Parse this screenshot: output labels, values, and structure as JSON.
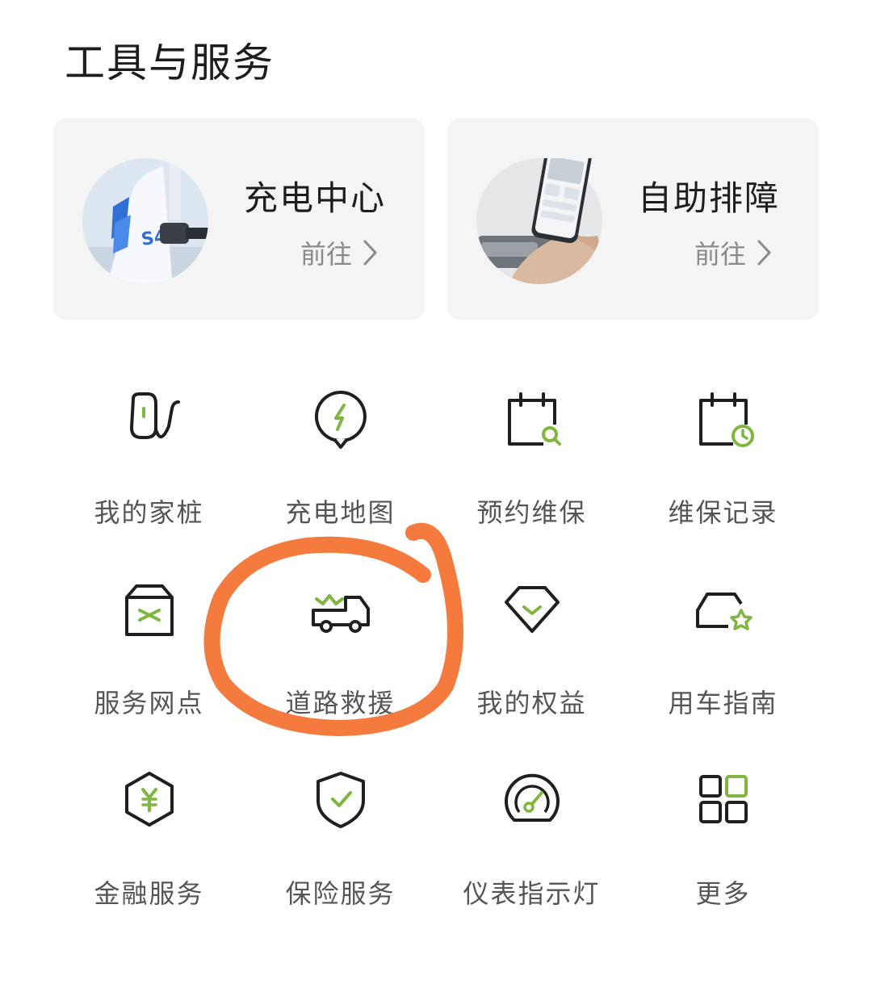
{
  "section": {
    "title": "工具与服务"
  },
  "cards": [
    {
      "title": "充电中心",
      "link": "前往"
    },
    {
      "title": "自助排障",
      "link": "前往"
    }
  ],
  "thumb_text": "S4",
  "tiles": [
    {
      "label": "我的家桩",
      "icon": "home-charger-icon"
    },
    {
      "label": "充电地图",
      "icon": "charging-map-icon"
    },
    {
      "label": "预约维保",
      "icon": "maintenance-booking-icon"
    },
    {
      "label": "维保记录",
      "icon": "maintenance-record-icon"
    },
    {
      "label": "服务网点",
      "icon": "service-outlet-icon"
    },
    {
      "label": "道路救援",
      "icon": "roadside-rescue-icon"
    },
    {
      "label": "我的权益",
      "icon": "benefits-icon"
    },
    {
      "label": "用车指南",
      "icon": "car-guide-icon"
    },
    {
      "label": "金融服务",
      "icon": "finance-icon"
    },
    {
      "label": "保险服务",
      "icon": "insurance-icon"
    },
    {
      "label": "仪表指示灯",
      "icon": "dashboard-light-icon"
    },
    {
      "label": "更多",
      "icon": "more-grid-icon"
    }
  ],
  "colors": {
    "accent": "#7fb640",
    "ink": "#1f1f1f",
    "annotation": "#f47a3d",
    "card_bg": "#f4f4f4"
  }
}
